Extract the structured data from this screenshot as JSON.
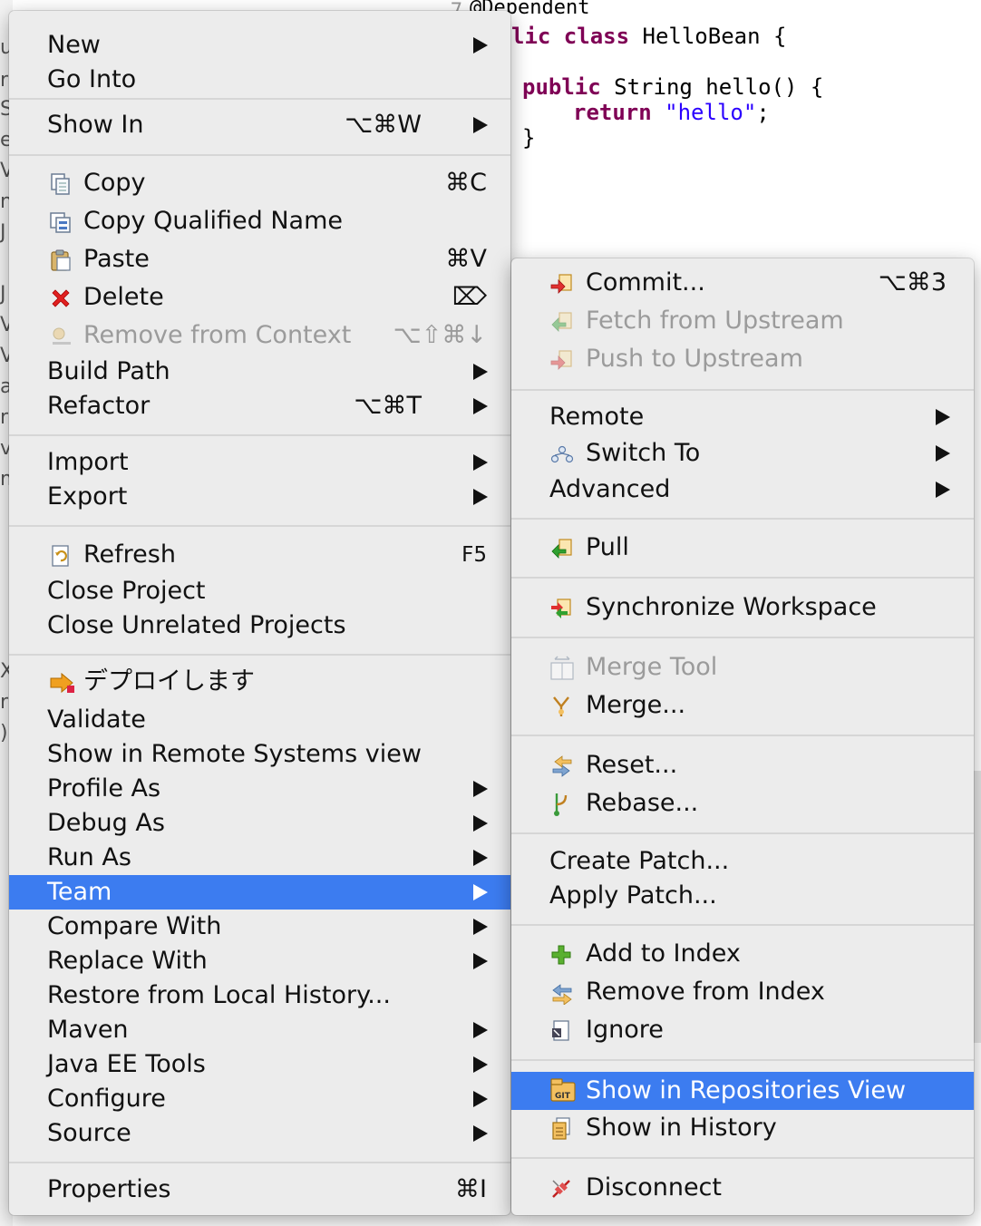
{
  "editor": {
    "line_number": "7",
    "code": {
      "annotation": "@Dependent",
      "class_decl_kw": "lic class",
      "class_decl_rest": " HelloBean {",
      "method_kw": "public",
      "method_rest": " String hello() {",
      "return_kw": "return",
      "return_str": "\"hello\"",
      "return_end": ";",
      "close_brace": "}"
    },
    "left_fragments": [
      "ul",
      "r",
      "S",
      "es",
      "Vi",
      "n",
      "J",
      "J",
      "Vi",
      "Vt",
      "a",
      "ri",
      "ve",
      "m",
      "X",
      "r",
      ")"
    ]
  },
  "main_menu": {
    "items": [
      {
        "label": "New",
        "shortcut": "",
        "submenu": true
      },
      {
        "label": "Go Into",
        "shortcut": "",
        "submenu": false
      },
      {
        "label": "Show In",
        "shortcut": "⌥⌘W",
        "submenu": true
      },
      {
        "label": "Copy",
        "shortcut": "⌘C",
        "submenu": false,
        "icon": "copy-icon"
      },
      {
        "label": "Copy Qualified Name",
        "shortcut": "",
        "submenu": false,
        "icon": "copy-qualified-name-icon"
      },
      {
        "label": "Paste",
        "shortcut": "⌘V",
        "submenu": false,
        "icon": "paste-icon"
      },
      {
        "label": "Delete",
        "shortcut": "⌦",
        "submenu": false,
        "icon": "delete-icon"
      },
      {
        "label": "Remove from Context",
        "shortcut": "⌥⇧⌘↓",
        "submenu": false,
        "icon": "remove-context-icon",
        "disabled": true
      },
      {
        "label": "Build Path",
        "shortcut": "",
        "submenu": true
      },
      {
        "label": "Refactor",
        "shortcut": "⌥⌘T",
        "submenu": true
      },
      {
        "label": "Import",
        "shortcut": "",
        "submenu": true
      },
      {
        "label": "Export",
        "shortcut": "",
        "submenu": true
      },
      {
        "label": "Refresh",
        "shortcut": "F5",
        "submenu": false,
        "icon": "refresh-icon"
      },
      {
        "label": "Close Project",
        "shortcut": "",
        "submenu": false
      },
      {
        "label": "Close Unrelated Projects",
        "shortcut": "",
        "submenu": false
      },
      {
        "label": "デプロイします",
        "shortcut": "",
        "submenu": false,
        "icon": "deploy-icon"
      },
      {
        "label": "Validate",
        "shortcut": "",
        "submenu": false
      },
      {
        "label": "Show in Remote Systems view",
        "shortcut": "",
        "submenu": false
      },
      {
        "label": "Profile As",
        "shortcut": "",
        "submenu": true
      },
      {
        "label": "Debug As",
        "shortcut": "",
        "submenu": true
      },
      {
        "label": "Run As",
        "shortcut": "",
        "submenu": true
      },
      {
        "label": "Team",
        "shortcut": "",
        "submenu": true,
        "active": true
      },
      {
        "label": "Compare With",
        "shortcut": "",
        "submenu": true
      },
      {
        "label": "Replace With",
        "shortcut": "",
        "submenu": true
      },
      {
        "label": "Restore from Local History...",
        "shortcut": "",
        "submenu": false
      },
      {
        "label": "Maven",
        "shortcut": "",
        "submenu": true
      },
      {
        "label": "Java EE Tools",
        "shortcut": "",
        "submenu": true
      },
      {
        "label": "Configure",
        "shortcut": "",
        "submenu": true
      },
      {
        "label": "Source",
        "shortcut": "",
        "submenu": true
      },
      {
        "label": "Properties",
        "shortcut": "⌘I",
        "submenu": false
      }
    ]
  },
  "team_menu": {
    "items": [
      {
        "label": "Commit...",
        "shortcut": "⌥⌘3",
        "submenu": false,
        "icon": "commit-icon"
      },
      {
        "label": "Fetch from Upstream",
        "shortcut": "",
        "submenu": false,
        "icon": "fetch-icon",
        "disabled": true
      },
      {
        "label": "Push to Upstream",
        "shortcut": "",
        "submenu": false,
        "icon": "push-icon",
        "disabled": true
      },
      {
        "label": "Remote",
        "shortcut": "",
        "submenu": true
      },
      {
        "label": "Switch To",
        "shortcut": "",
        "submenu": true,
        "icon": "switch-branch-icon"
      },
      {
        "label": "Advanced",
        "shortcut": "",
        "submenu": true
      },
      {
        "label": "Pull",
        "shortcut": "",
        "submenu": false,
        "icon": "pull-icon"
      },
      {
        "label": "Synchronize Workspace",
        "shortcut": "",
        "submenu": false,
        "icon": "synchronize-icon"
      },
      {
        "label": "Merge Tool",
        "shortcut": "",
        "submenu": false,
        "icon": "merge-tool-icon",
        "disabled": true
      },
      {
        "label": "Merge...",
        "shortcut": "",
        "submenu": false,
        "icon": "merge-icon"
      },
      {
        "label": "Reset...",
        "shortcut": "",
        "submenu": false,
        "icon": "reset-icon"
      },
      {
        "label": "Rebase...",
        "shortcut": "",
        "submenu": false,
        "icon": "rebase-icon"
      },
      {
        "label": "Create Patch...",
        "shortcut": "",
        "submenu": false
      },
      {
        "label": "Apply Patch...",
        "shortcut": "",
        "submenu": false
      },
      {
        "label": "Add to Index",
        "shortcut": "",
        "submenu": false,
        "icon": "add-index-icon"
      },
      {
        "label": "Remove from Index",
        "shortcut": "",
        "submenu": false,
        "icon": "remove-index-icon"
      },
      {
        "label": "Ignore",
        "shortcut": "",
        "submenu": false,
        "icon": "ignore-icon"
      },
      {
        "label": "Show in Repositories View",
        "shortcut": "",
        "submenu": false,
        "icon": "git-repository-icon",
        "active": true
      },
      {
        "label": "Show in History",
        "shortcut": "",
        "submenu": false,
        "icon": "history-icon"
      },
      {
        "label": "Disconnect",
        "shortcut": "",
        "submenu": false,
        "icon": "disconnect-icon"
      }
    ]
  },
  "colors": {
    "highlight": "#3c7cf0",
    "menu_bg": "#ececec",
    "disabled_text": "#9b9b9b",
    "keyword": "#7f0055",
    "string": "#2a00ff"
  }
}
